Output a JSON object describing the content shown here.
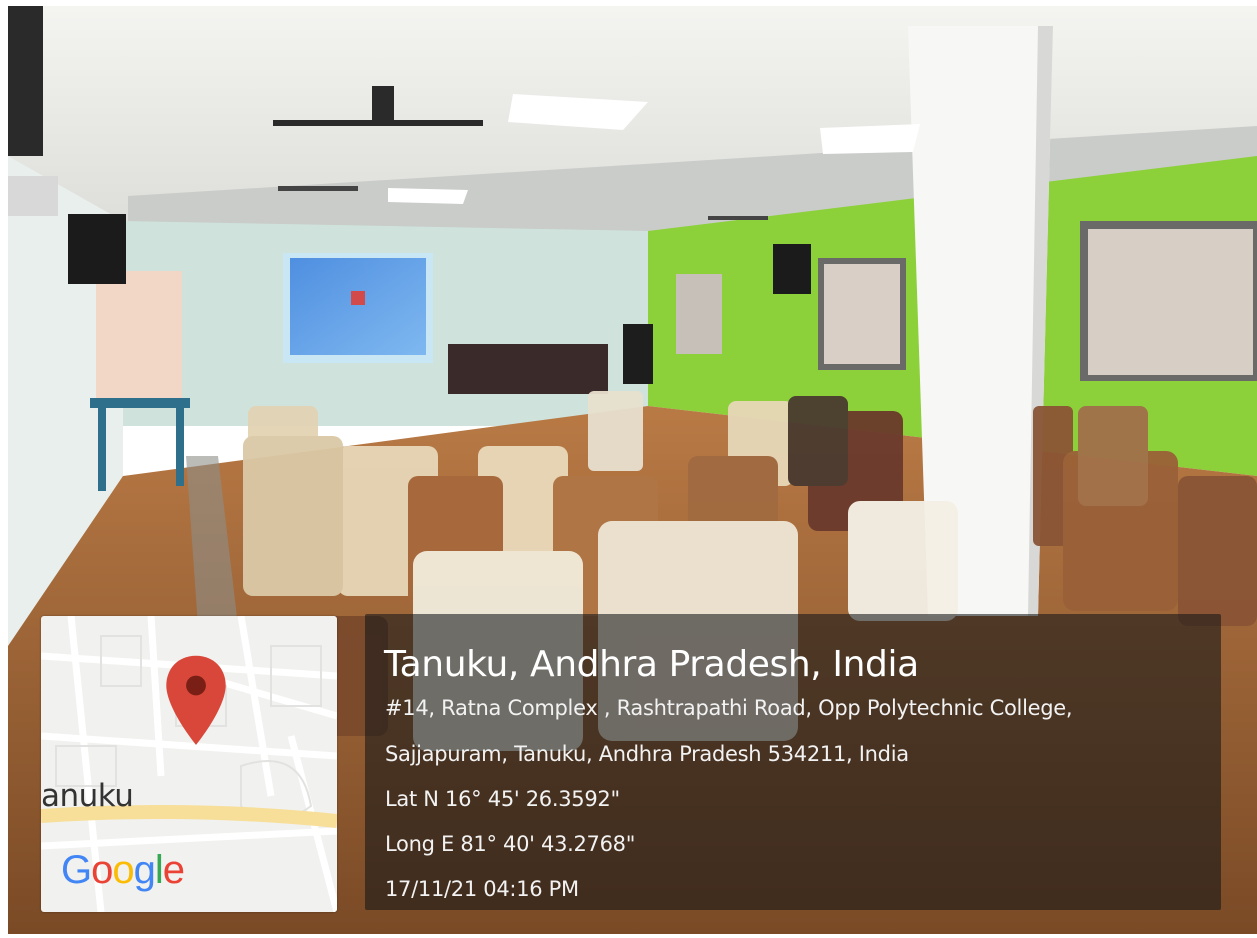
{
  "map": {
    "place_label": "anuku",
    "logo": {
      "letters": [
        {
          "char": "G",
          "color": "#4285F4"
        },
        {
          "char": "o",
          "color": "#EA4335"
        },
        {
          "char": "o",
          "color": "#FBBC05"
        },
        {
          "char": "g",
          "color": "#4285F4"
        },
        {
          "char": "l",
          "color": "#34A853"
        },
        {
          "char": "e",
          "color": "#EA4335"
        }
      ]
    },
    "pin_color": "#D9463A"
  },
  "info": {
    "title": "Tanuku, Andhra Pradesh, India",
    "address_line1": "#14, Ratna Complex , Rashtrapathi Road, Opp Polytechnic College,",
    "address_line2": "Sajjapuram, Tanuku, Andhra Pradesh 534211, India",
    "latitude": "Lat N 16° 45' 26.3592\"",
    "longitude": "Long E 81° 40' 43.2768\"",
    "timestamp": "17/11/21 04:16 PM"
  },
  "scene": {
    "wall_left_color": "#cfe3dc",
    "wall_right_color": "#8fd33a",
    "floor_color": "#a86a3a",
    "ceiling_color": "#eeeeea"
  }
}
